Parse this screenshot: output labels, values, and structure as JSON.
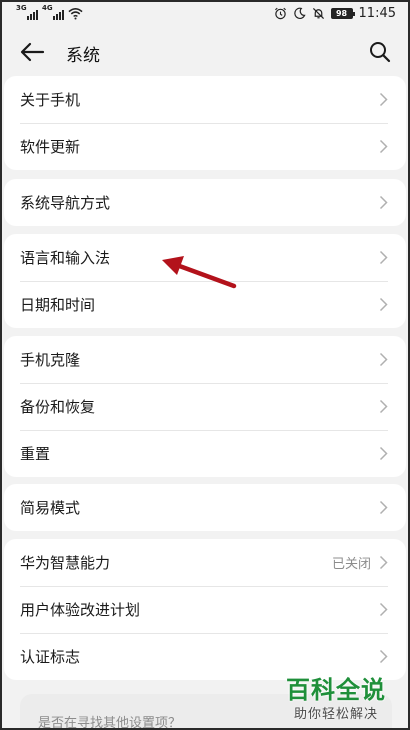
{
  "status_bar": {
    "signal1_tag": "3G",
    "signal2_tag": "4G",
    "battery": "98",
    "time": "11:45"
  },
  "header": {
    "title": "系统"
  },
  "groups": [
    {
      "rows": [
        {
          "label": "关于手机"
        },
        {
          "label": "软件更新"
        }
      ]
    },
    {
      "rows": [
        {
          "label": "系统导航方式"
        }
      ]
    },
    {
      "rows": [
        {
          "label": "语言和输入法"
        },
        {
          "label": "日期和时间"
        }
      ]
    },
    {
      "rows": [
        {
          "label": "手机克隆"
        },
        {
          "label": "备份和恢复"
        },
        {
          "label": "重置"
        }
      ]
    },
    {
      "rows": [
        {
          "label": "简易模式"
        }
      ]
    },
    {
      "rows": [
        {
          "label": "华为智慧能力",
          "value": "已关闭"
        },
        {
          "label": "用户体验改进计划"
        },
        {
          "label": "认证标志"
        }
      ]
    }
  ],
  "prompt": {
    "text": "是否在寻找其他设置项？"
  },
  "watermark": {
    "main": "百科全说",
    "sub": "助你轻松解决"
  },
  "colors": {
    "background": "#f2f2f2",
    "card": "#ffffff",
    "annotation_arrow": "#b3121b",
    "watermark_green": "#1f8f3a"
  }
}
